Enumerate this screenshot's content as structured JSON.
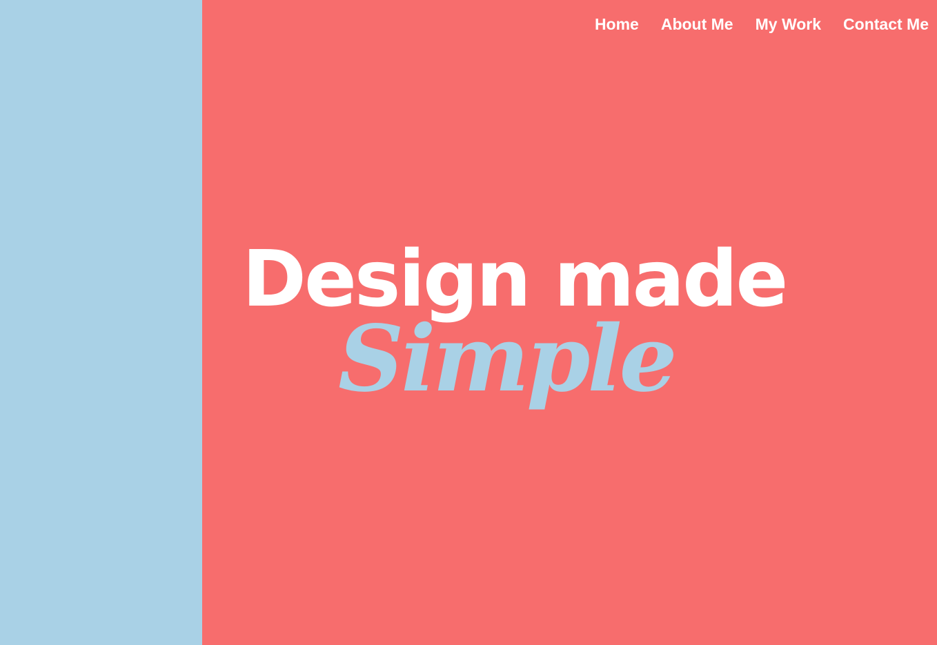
{
  "nav": {
    "items": [
      {
        "label": "Home"
      },
      {
        "label": "About Me"
      },
      {
        "label": "My Work"
      },
      {
        "label": "Contact Me"
      }
    ]
  },
  "hero": {
    "line1": "Design made",
    "line2": "Simple"
  },
  "colors": {
    "sidebar": "#a9d1e6",
    "main": "#f76d6d",
    "text": "#ffffff",
    "accent": "#a9d1e6"
  }
}
